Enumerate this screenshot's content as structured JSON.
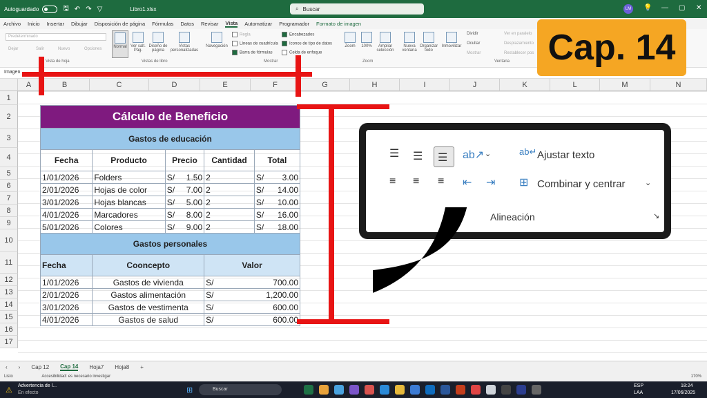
{
  "titlebar": {
    "autosave": "Autoguardado",
    "filename": "Libro1.xlsx",
    "search": "Buscar",
    "user_initials": "LM"
  },
  "menu": [
    "Archivo",
    "Inicio",
    "Insertar",
    "Dibujar",
    "Disposición de página",
    "Fórmulas",
    "Datos",
    "Revisar",
    "Vista",
    "Automatizar",
    "Programador",
    "Formato de imagen"
  ],
  "ribbon": {
    "view_dropdown": "Predeterminado",
    "sheet_view_btns": [
      "Dejar",
      "Salir",
      "Nuevo",
      "Opciones"
    ],
    "group_sheet_view": "Vista de hoja",
    "normal": "Normal",
    "page_break": "Ver salt. Pág.",
    "page_layout": "Diseño de página",
    "custom_views": "Vistas personalizadas",
    "group_workbook_views": "Vistas de libro",
    "navigation": "Navegación",
    "show": [
      "Regla",
      "Líneas de cuadrícula",
      "Barra de fórmulas",
      "Encabezados",
      "Iconos de tipo de datos",
      "Celda de enfoque"
    ],
    "group_show": "Mostrar",
    "zoom": "Zoom",
    "zoom100": "100%",
    "zoom_sel": "Ampliar selección",
    "group_zoom": "Zoom",
    "new_window": "Nueva ventana",
    "arrange": "Organizar todo",
    "freeze": "Inmovilizar",
    "split": "Dividir",
    "hide": "Ocultar",
    "show_win": "Mostrar",
    "side_by_side": "Ver en paralelo",
    "sync_scroll": "Desplazamiento",
    "reset_pos": "Restablecer pos",
    "group_window": "Ventana"
  },
  "namebox": "Imagen",
  "columns": [
    "A",
    "B",
    "C",
    "D",
    "E",
    "F",
    "G",
    "H",
    "I",
    "J",
    "K",
    "L",
    "M",
    "N"
  ],
  "rows": [
    "1",
    "2",
    "3",
    "4",
    "5",
    "6",
    "7",
    "8",
    "9",
    "10",
    "11",
    "12",
    "13",
    "14",
    "15",
    "16",
    "17"
  ],
  "sheet": {
    "title": "Cálculo de Beneficio",
    "section1": "Gastos de educación",
    "headers1": [
      "Fecha",
      "Producto",
      "Precio",
      "Cantidad",
      "Total"
    ],
    "rows1": [
      [
        "1/01/2026",
        "Folders",
        "S/",
        "1.50",
        "2",
        "S/",
        "3.00"
      ],
      [
        "2/01/2026",
        "Hojas de color",
        "S/",
        "7.00",
        "2",
        "S/",
        "14.00"
      ],
      [
        "3/01/2026",
        "Hojas blancas",
        "S/",
        "5.00",
        "2",
        "S/",
        "10.00"
      ],
      [
        "4/01/2026",
        "Marcadores",
        "S/",
        "8.00",
        "2",
        "S/",
        "16.00"
      ],
      [
        "5/01/2026",
        "Colores",
        "S/",
        "9.00",
        "2",
        "S/",
        "18.00"
      ]
    ],
    "section2": "Gastos personales",
    "headers2": [
      "Fecha",
      "Cooncepto",
      "Valor"
    ],
    "rows2": [
      [
        "1/01/2026",
        "Gastos de vivienda",
        "S/",
        "700.00"
      ],
      [
        "2/01/2026",
        "Gastos alimentación",
        "S/",
        "1,200.00"
      ],
      [
        "3/01/2026",
        "Gastos de vestimenta",
        "S/",
        "600.00"
      ],
      [
        "4/01/2026",
        "Gastos de salud",
        "S/",
        "600.00"
      ]
    ]
  },
  "callout": {
    "wrap": "Ajustar texto",
    "merge": "Combinar y centrar",
    "group": "Alineación"
  },
  "badge": "Cap. 14",
  "tabs": [
    "Cap 12",
    "Cap 14",
    "Hoja7",
    "Hoja8"
  ],
  "status": {
    "ready": "Listo",
    "accessibility": "Accesibilidad: es necesario investigar",
    "zoom": "170%"
  },
  "taskbar": {
    "warning_title": "Advertencia de l...",
    "warning_sub": "En efecto",
    "search": "Buscar",
    "lang": "ESP",
    "region": "LAA",
    "time": "18:24",
    "date": "17/06/2025"
  }
}
